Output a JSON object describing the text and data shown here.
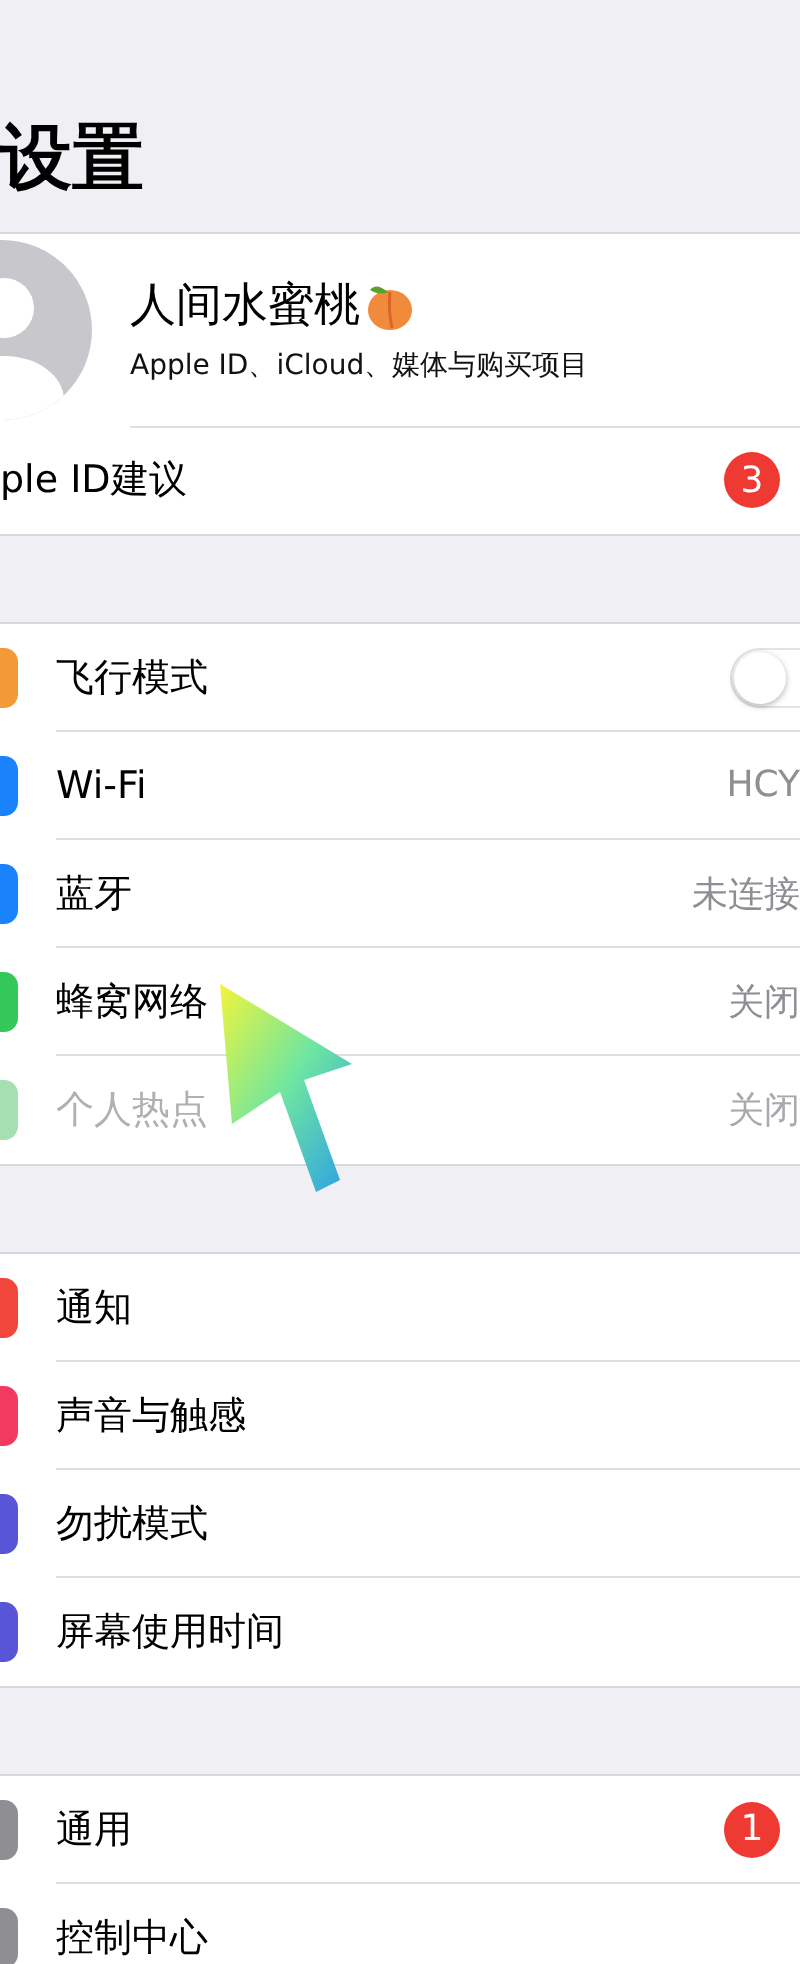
{
  "title": "设置",
  "profile": {
    "name": "人间水蜜桃",
    "subtitle": "Apple ID、iCloud、媒体与购买项目"
  },
  "suggestion": {
    "label": "ple ID建议",
    "badge": "3"
  },
  "groups": [
    {
      "rows": [
        {
          "kind": "toggle",
          "label": "飞行模式",
          "color": "#f19a37",
          "on": false,
          "disabled": false
        },
        {
          "kind": "value",
          "label": "Wi-Fi",
          "value": "HCY",
          "color": "#1a82fb",
          "disabled": false
        },
        {
          "kind": "value",
          "label": "蓝牙",
          "value": "未连接",
          "color": "#1a82fb",
          "disabled": false
        },
        {
          "kind": "value",
          "label": "蜂窝网络",
          "value": "关闭",
          "color": "#34c759",
          "disabled": false
        },
        {
          "kind": "value",
          "label": "个人热点",
          "value": "关闭",
          "color": "#a6dfb0",
          "disabled": true
        }
      ]
    },
    {
      "rows": [
        {
          "kind": "plain",
          "label": "通知",
          "color": "#f0463c",
          "disabled": false
        },
        {
          "kind": "plain",
          "label": "声音与触感",
          "color": "#f03a5f",
          "disabled": false
        },
        {
          "kind": "plain",
          "label": "勿扰模式",
          "color": "#5856d6",
          "disabled": false
        },
        {
          "kind": "plain",
          "label": "屏幕使用时间",
          "color": "#5856d6",
          "disabled": false
        }
      ]
    },
    {
      "rows": [
        {
          "kind": "badge",
          "label": "通用",
          "badge": "1",
          "color": "#8e8e93",
          "disabled": false
        },
        {
          "kind": "plain",
          "label": "控制中心",
          "color": "#8e8e93",
          "disabled": false
        }
      ]
    }
  ]
}
